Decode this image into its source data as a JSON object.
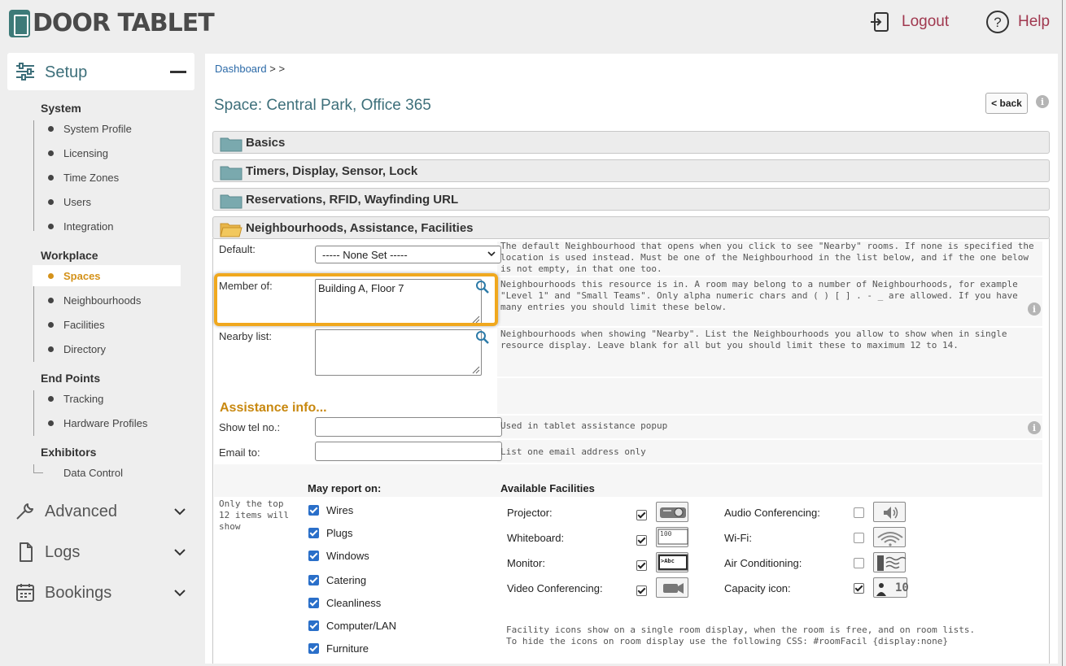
{
  "header": {
    "logo_text": "DOOR TABLET",
    "logout_label": "Logout",
    "help_label": "Help",
    "accent_color": "#a0384f"
  },
  "sidebar": {
    "setup_label": "Setup",
    "sections": {
      "system": "System",
      "workplace": "Workplace",
      "endpoints": "End Points",
      "exhibitors": "Exhibitors"
    },
    "items": {
      "system_profile": "System Profile",
      "licensing": "Licensing",
      "time_zones": "Time Zones",
      "users": "Users",
      "integration": "Integration",
      "spaces": "Spaces",
      "neighbourhoods": "Neighbourhoods",
      "facilities": "Facilities",
      "directory": "Directory",
      "tracking": "Tracking",
      "hardware_profiles": "Hardware Profiles",
      "data_control": "Data Control"
    },
    "groups": {
      "advanced": "Advanced",
      "logs": "Logs",
      "bookings": "Bookings"
    },
    "active_color": "#d4921a"
  },
  "main": {
    "breadcrumb_dashboard": "Dashboard",
    "breadcrumb_sep1": ">",
    "breadcrumb_sep2": ">",
    "title": "Space: Central Park, Office 365",
    "back_label": "< back",
    "info_glyph": "i",
    "sections": {
      "basics": "Basics",
      "timers": "Timers, Display, Sensor, Lock",
      "reservations": "Reservations, RFID, Wayfinding URL",
      "neighbourhoods": "Neighbourhoods, Assistance, Facilities"
    },
    "form": {
      "default_label": "Default:",
      "default_value": "----- None Set -----",
      "default_help": "The default Neighbourhood that opens when you click to see \"Nearby\" rooms. If none is specified the location is used instead. Must be one of the Neighbourhood in the list below, and if the one below is not empty, in that one too.",
      "member_label": "Member of:",
      "member_value": "Building A, Floor 7",
      "member_help": "Neighbourhoods this resource is in. A room may belong to a number of Neighbourhoods, for example \"Level 1\" and \"Small Teams\". Only alpha numeric chars and ( ) [ ] . - _ are allowed. If you have many entries you should limit these below.",
      "nearby_label": "Nearby list:",
      "nearby_value": "",
      "nearby_help": "Neighbourhoods when showing \"Nearby\". List the Neighbourhoods you allow to show when in single resource display. Leave blank for all but you should limit these to maximum 12 to 14.",
      "assist_title": "Assistance info...",
      "tel_label": "Show tel no.:",
      "tel_value": "",
      "tel_help": "Used in tablet assistance popup",
      "email_label": "Email to:",
      "email_value": "",
      "email_help": "List one email address only"
    },
    "report": {
      "note": "Only the top 12 items will show",
      "heading": "May report on:",
      "items": [
        {
          "label": "Wires",
          "checked": true
        },
        {
          "label": "Plugs",
          "checked": true
        },
        {
          "label": "Windows",
          "checked": true
        },
        {
          "label": "Catering",
          "checked": true
        },
        {
          "label": "Cleanliness",
          "checked": true
        },
        {
          "label": "Computer/LAN",
          "checked": true
        },
        {
          "label": "Furniture",
          "checked": true
        }
      ]
    },
    "facilities": {
      "heading": "Available Facilities",
      "left": [
        {
          "label": "Projector:",
          "checked": true,
          "icon": "projector-icon"
        },
        {
          "label": "Whiteboard:",
          "checked": true,
          "icon": "whiteboard-icon",
          "icon_text": "100"
        },
        {
          "label": "Monitor:",
          "checked": true,
          "icon": "monitor-icon",
          "icon_text": ">Abc"
        },
        {
          "label": "Video Conferencing:",
          "checked": true,
          "icon": "video-camera-icon"
        }
      ],
      "right": [
        {
          "label": "Audio Conferencing:",
          "checked": false,
          "icon": "speaker-icon"
        },
        {
          "label": "Wi-Fi:",
          "checked": false,
          "icon": "wifi-icon"
        },
        {
          "label": "Air Conditioning:",
          "checked": false,
          "icon": "air-conditioning-icon"
        },
        {
          "label": "Capacity icon:",
          "checked": true,
          "icon": "capacity-icon",
          "icon_text": "10"
        }
      ],
      "note_line1": "Facility icons show on a single room display, when the room is free, and on room lists.",
      "note_line2": "To hide the icons on room display use the following CSS: #roomFacil {display:none}"
    }
  }
}
